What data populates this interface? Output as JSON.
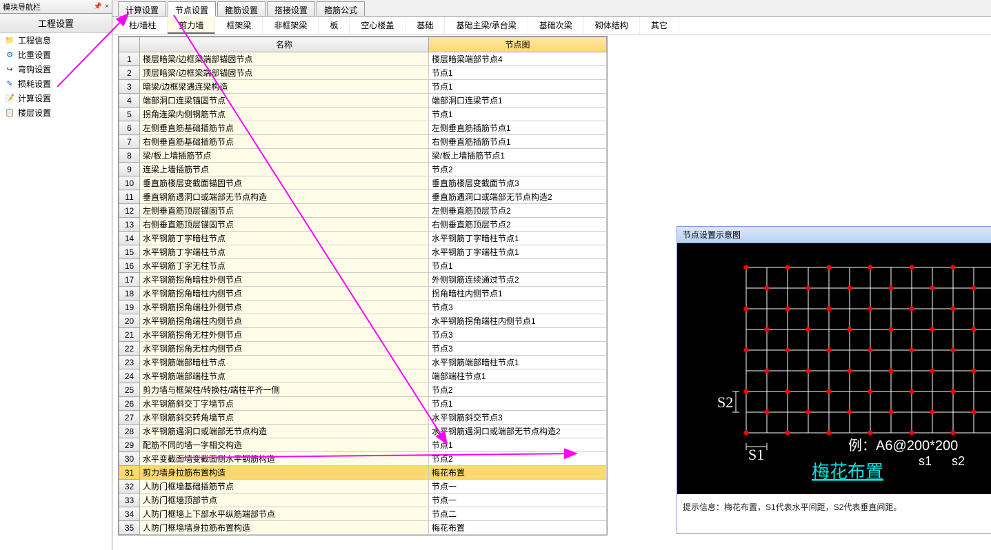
{
  "sidebar": {
    "header": "模块导航栏",
    "title": "工程设置",
    "items": [
      {
        "label": "工程信息",
        "icon": "📁",
        "color": "#d98a00"
      },
      {
        "label": "比重设置",
        "icon": "⚙",
        "color": "#0066cc"
      },
      {
        "label": "弯钩设置",
        "icon": "↪",
        "color": "#cc0000"
      },
      {
        "label": "损耗设置",
        "icon": "✎",
        "color": "#0066cc"
      },
      {
        "label": "计算设置",
        "icon": "📝",
        "color": "#0066cc"
      },
      {
        "label": "楼层设置",
        "icon": "📋",
        "color": "#0066cc"
      }
    ]
  },
  "topTabs": [
    "计算设置",
    "节点设置",
    "箍筋设置",
    "搭接设置",
    "箍筋公式"
  ],
  "topTabActive": 1,
  "subTabs": [
    "柱/墙柱",
    "剪力墙",
    "框架梁",
    "非框架梁",
    "板",
    "空心楼盖",
    "基础",
    "基础主梁/承台梁",
    "基础次梁",
    "砌体结构",
    "其它"
  ],
  "subTabActive": 1,
  "table": {
    "headers": [
      "",
      "名称",
      "节点图"
    ],
    "rows": [
      {
        "n": 1,
        "name": "楼层暗梁/边框梁端部锚固节点",
        "diagram": "楼层暗梁端部节点4"
      },
      {
        "n": 2,
        "name": "顶层暗梁/边框梁端部锚固节点",
        "diagram": "节点1"
      },
      {
        "n": 3,
        "name": "暗梁/边框梁遇连梁构造",
        "diagram": "节点1"
      },
      {
        "n": 4,
        "name": "端部洞口连梁锚固节点",
        "diagram": "端部洞口连梁节点1"
      },
      {
        "n": 5,
        "name": "拐角连梁内侧钢筋节点",
        "diagram": "节点1"
      },
      {
        "n": 6,
        "name": "左侧垂直筋基础插筋节点",
        "diagram": "左侧垂直筋插筋节点1"
      },
      {
        "n": 7,
        "name": "右侧垂直筋基础插筋节点",
        "diagram": "右侧垂直筋插筋节点1"
      },
      {
        "n": 8,
        "name": "梁/板上墙插筋节点",
        "diagram": "梁/板上墙插筋节点1"
      },
      {
        "n": 9,
        "name": "连梁上墙插筋节点",
        "diagram": "节点2"
      },
      {
        "n": 10,
        "name": "垂直筋楼层变截面锚固节点",
        "diagram": "垂直筋楼层变截面节点3"
      },
      {
        "n": 11,
        "name": "垂直钢筋遇洞口或端部无节点构造",
        "diagram": "垂直筋遇洞口或端部无节点构造2"
      },
      {
        "n": 12,
        "name": "左侧垂直筋顶层锚固节点",
        "diagram": "左侧垂直筋顶层节点2"
      },
      {
        "n": 13,
        "name": "右侧垂直筋顶层锚固节点",
        "diagram": "右侧垂直筋顶层节点2"
      },
      {
        "n": 14,
        "name": "水平钢筋丁字暗柱节点",
        "diagram": "水平钢筋丁字暗柱节点1"
      },
      {
        "n": 15,
        "name": "水平钢筋丁字端柱节点",
        "diagram": "水平钢筋丁字端柱节点1"
      },
      {
        "n": 16,
        "name": "水平钢筋丁字无柱节点",
        "diagram": "节点1"
      },
      {
        "n": 17,
        "name": "水平钢筋拐角暗柱外侧节点",
        "diagram": "外侧钢筋连续通过节点2"
      },
      {
        "n": 18,
        "name": "水平钢筋拐角暗柱内侧节点",
        "diagram": "拐角暗柱内侧节点1"
      },
      {
        "n": 19,
        "name": "水平钢筋拐角端柱外侧节点",
        "diagram": "节点3"
      },
      {
        "n": 20,
        "name": "水平钢筋拐角端柱内侧节点",
        "diagram": "水平钢筋拐角端柱内侧节点1"
      },
      {
        "n": 21,
        "name": "水平钢筋拐角无柱外侧节点",
        "diagram": "节点3"
      },
      {
        "n": 22,
        "name": "水平钢筋拐角无柱内侧节点",
        "diagram": "节点3"
      },
      {
        "n": 23,
        "name": "水平钢筋端部暗柱节点",
        "diagram": "水平钢筋端部暗柱节点1"
      },
      {
        "n": 24,
        "name": "水平钢筋端部端柱节点",
        "diagram": "端部端柱节点1"
      },
      {
        "n": 25,
        "name": "剪力墙与框架柱/转换柱/端柱平齐一侧",
        "diagram": "节点2"
      },
      {
        "n": 26,
        "name": "水平钢筋斜交丁字墙节点",
        "diagram": "节点1"
      },
      {
        "n": 27,
        "name": "水平钢筋斜交转角墙节点",
        "diagram": "水平钢筋斜交节点3"
      },
      {
        "n": 28,
        "name": "水平钢筋遇洞口或端部无节点构造",
        "diagram": "水平钢筋遇洞口或端部无节点构造2"
      },
      {
        "n": 29,
        "name": "配筋不同的墙一字相交构造",
        "diagram": "节点1"
      },
      {
        "n": 30,
        "name": "水平变截面墙变截面侧水平钢筋构造",
        "diagram": "节点2"
      },
      {
        "n": 31,
        "name": "剪力墙身拉筋布置构造",
        "diagram": "梅花布置",
        "selected": true
      },
      {
        "n": 32,
        "name": "人防门框墙基础插筋节点",
        "diagram": "节点一"
      },
      {
        "n": 33,
        "name": "人防门框墙顶部节点",
        "diagram": "节点一"
      },
      {
        "n": 34,
        "name": "人防门框墙上下部水平纵筋端部节点",
        "diagram": "节点二"
      },
      {
        "n": 35,
        "name": "人防门框墙墙身拉筋布置构造",
        "diagram": "梅花布置"
      }
    ]
  },
  "diagram": {
    "title": "节点设置示意图",
    "labels": {
      "s1": "S1",
      "s2": "S2",
      "example": "例：A6@200*200",
      "s1label": "s1",
      "s2label": "s2",
      "caption": "梅花布置"
    },
    "hint": "提示信息：梅花布置，S1代表水平间距，S2代表垂直间距。"
  },
  "chart_data": {
    "type": "diagram",
    "grid": {
      "cols": 12,
      "rows": 8
    },
    "pattern": "plum-blossom-staggered",
    "dot_spacing_label_h": "S1",
    "dot_spacing_label_v": "S2",
    "example_spec": "A6@200*200"
  }
}
